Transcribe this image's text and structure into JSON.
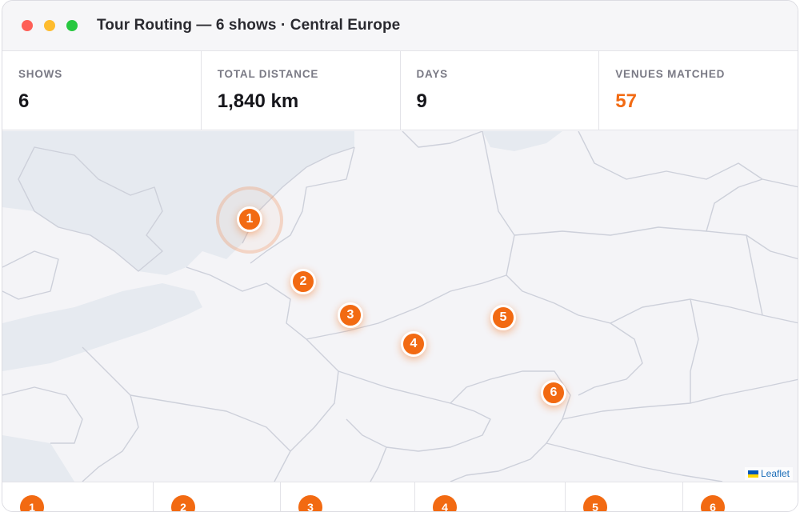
{
  "window": {
    "title": "Tour Routing — 6 shows · Central Europe"
  },
  "stats": [
    {
      "label": "SHOWS",
      "value": "6"
    },
    {
      "label": "TOTAL DISTANCE",
      "value": "1,840 km"
    },
    {
      "label": "DAYS",
      "value": "9"
    },
    {
      "label": "VENUES MATCHED",
      "value": "57"
    }
  ],
  "map": {
    "markers": [
      "1",
      "2",
      "3",
      "4",
      "5",
      "6"
    ],
    "attribution": "Leaflet"
  },
  "stops": [
    {
      "number": "1"
    },
    {
      "number": "2"
    },
    {
      "number": "3"
    },
    {
      "number": "4"
    },
    {
      "number": "5"
    },
    {
      "number": "6"
    }
  ],
  "colors": {
    "accent": "#f26a12",
    "sea": "#e6eaf0",
    "land": "#f4f4f7",
    "border": "#cdd0da"
  }
}
